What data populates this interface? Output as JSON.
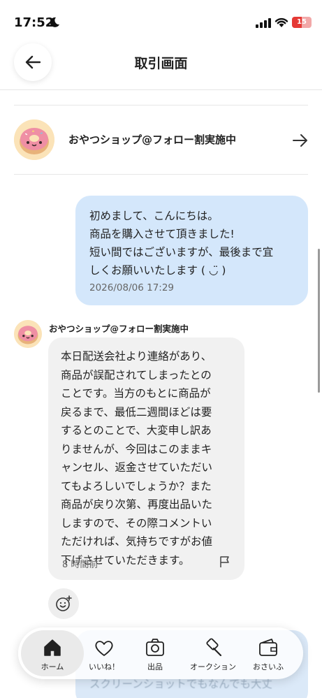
{
  "status_bar": {
    "time": "17:52",
    "battery": "15"
  },
  "header": {
    "title": "取引画面"
  },
  "shop": {
    "name": "おやつショップ@フォロー割実施中"
  },
  "messages": {
    "own": {
      "body": "初めまして、こんにちは。\n商品を購入させて頂きました!\n短い間ではございますが、最後まで宜\nしくお願いいたします ( ◡̈ )",
      "time": "2026/08/06 17:29"
    },
    "partner": {
      "name": "おやつショップ@フォロー割実施中",
      "body": "本日配送会社より連絡があり、\n商品が誤配されてしまったとの\nことです。当方のもとに商品が\n戻るまで、最低二週間ほどは要\nするとのことで、大変申し訳あ\nりませんが、今回はこのままキ\nャンセル、返金させていただい\nてもよろしいでしょうか？また\n商品が戻り次第、再度出品いた\nしますので、その際コメントい\nただければ、気持ちですがお値\n下げさせていただきます。",
      "time": "8 時間前"
    },
    "behind_text": "スクリーンショットでもなんでも大丈"
  },
  "bottom_nav": {
    "items": [
      {
        "label": "ホーム",
        "icon": "home-icon",
        "active": true
      },
      {
        "label": "いいね！",
        "icon": "heart-icon",
        "active": false
      },
      {
        "label": "出品",
        "icon": "camera-icon",
        "active": false
      },
      {
        "label": "オークション",
        "icon": "hammer-icon",
        "active": false
      },
      {
        "label": "おさいふ",
        "icon": "wallet-icon",
        "active": false
      }
    ]
  },
  "colors": {
    "own_bubble": "#d4e7fb",
    "partner_bubble": "#f1f1f1",
    "battery": "#e53935"
  }
}
